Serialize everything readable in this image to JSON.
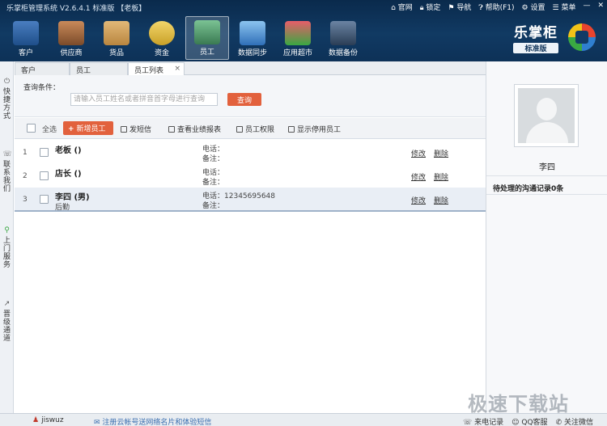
{
  "window": {
    "title": "乐掌柜管理系统 V2.6.4.1 标准版 【老板】",
    "links": [
      {
        "icon": "home-icon",
        "label": "官网"
      },
      {
        "icon": "lock-icon",
        "label": "锁定"
      },
      {
        "icon": "navigation-icon",
        "label": "导航"
      },
      {
        "icon": "help-icon",
        "label": "帮助(F1)"
      },
      {
        "icon": "settings-icon",
        "label": "设置"
      },
      {
        "icon": "menu-icon",
        "label": "菜单"
      },
      {
        "icon": "minimize-icon",
        "label": "—"
      },
      {
        "icon": "close-icon",
        "label": "✕"
      }
    ]
  },
  "toolbar": {
    "items": [
      {
        "label": "客户",
        "icon": "customer-icon",
        "color": "#1f4f8a"
      },
      {
        "label": "供应商",
        "icon": "supplier-icon",
        "color": "#7b4b2a"
      },
      {
        "label": "货品",
        "icon": "goods-icon",
        "color": "#b9863f"
      },
      {
        "label": "资金",
        "icon": "money-icon",
        "color": "#c9a128"
      },
      {
        "label": "员工",
        "icon": "employee-icon",
        "color": "#3a7a52"
      },
      {
        "label": "数据同步",
        "icon": "data-sync-icon",
        "color": "#2f6fb8"
      },
      {
        "label": "应用超市",
        "icon": "app-market-icon",
        "color": "#3aa842"
      },
      {
        "label": "数据备份",
        "icon": "data-backup-icon",
        "color": "#2a3d55"
      }
    ],
    "active_index": 4
  },
  "brand": {
    "name": "乐掌柜",
    "edition": "标准版"
  },
  "rail": {
    "items": [
      {
        "icon": "power-icon",
        "label": "快捷方式"
      },
      {
        "icon": "phone-icon",
        "label": "联系我们"
      },
      {
        "icon": "bike-icon",
        "label": "上门服务"
      },
      {
        "icon": "chart-icon",
        "label": "晋级通道"
      }
    ]
  },
  "tabs": [
    {
      "label": "客户"
    },
    {
      "label": "员工"
    },
    {
      "label": "员工列表",
      "close": "×"
    }
  ],
  "query": {
    "label": "查询条件：",
    "placeholder": "请输入员工姓名或者拼音首字母进行查询",
    "button": "查询"
  },
  "actions": {
    "select_all": "全选",
    "add": "新增员工",
    "add_plus": "+",
    "send_sms": "发短信",
    "view_performance": "查看业绩报表",
    "permissions": "员工权限",
    "show_disabled": "显示停用员工"
  },
  "employees": [
    {
      "num": "1",
      "name": "老板 ()",
      "position": "",
      "phone_label": "电话：",
      "phone": "",
      "note_label": "备注：",
      "edit": "修改",
      "delete": "删除"
    },
    {
      "num": "2",
      "name": "店长 ()",
      "position": "",
      "phone_label": "电话：",
      "phone": "",
      "note_label": "备注：",
      "edit": "修改",
      "delete": "删除"
    },
    {
      "num": "3",
      "name": "李四 (男)",
      "position": "后勤",
      "phone_label": "电话：",
      "phone": "12345695648",
      "note_label": "备注：",
      "edit": "修改",
      "delete": "删除"
    }
  ],
  "detail": {
    "name": "李四",
    "pending": "待处理的沟通记录0条"
  },
  "status": {
    "user": "jiswuz",
    "promo": "注册云帐号送网络名片和体验短信",
    "links": [
      "来电记录",
      "QQ客服",
      "关注微信"
    ]
  },
  "watermark": "极速下载站"
}
